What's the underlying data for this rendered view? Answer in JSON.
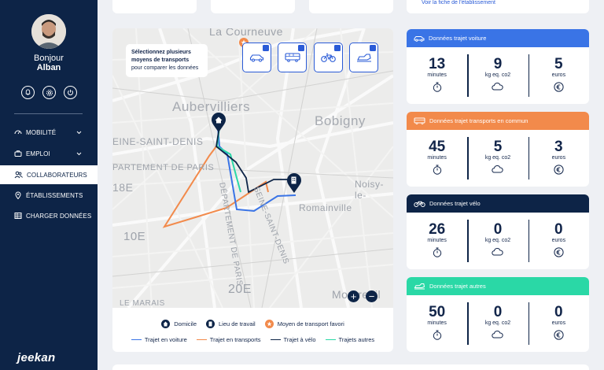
{
  "user": {
    "greeting": "Bonjour",
    "name": "Alban"
  },
  "nav": [
    {
      "label": "MOBILITÉ",
      "icon": "dashboard-icon",
      "has_chevron": true,
      "active": false
    },
    {
      "label": "EMPLOI",
      "icon": "briefcase-icon",
      "has_chevron": true,
      "active": false
    },
    {
      "label": "COLLABORATEURS",
      "icon": "users-icon",
      "has_chevron": false,
      "active": true
    },
    {
      "label": "ÉTABLISSEMENTS",
      "icon": "location-pin-icon",
      "has_chevron": false,
      "active": false
    },
    {
      "label": "CHARGER DONNÉES",
      "icon": "table-icon",
      "has_chevron": false,
      "active": false
    }
  ],
  "brand": {
    "logo": "jeekan"
  },
  "top_link": "Voir la fiche de l'établissement",
  "map": {
    "tip_bold": "Sélectionnez plusieurs moyens de transports",
    "tip_rest": "pour comparer les données",
    "labels": [
      "La Courneuve",
      "Aubervilliers",
      "Bobigny",
      "EINE-SAINT-DENIS",
      "PARTEMENT DE PARIS",
      "18E",
      "Noisy-le-",
      "Romainville",
      "10E",
      "DÉPARTEMENT DE PARIS",
      "SEINE-SAINT-DENIS",
      "20E",
      "Montreuil",
      "LE MARAIS"
    ],
    "legend_markers": [
      "Domicile",
      "Lieu de travail",
      "Moyen de transport favori"
    ],
    "legend_lines": [
      "Trajet en voiture",
      "Trajet en transports",
      "Trajet à vélo",
      "Trajets autres"
    ],
    "zoom_in": "+",
    "zoom_out": "−"
  },
  "colors": {
    "car": "#3a74e6",
    "transit": "#f28a4b",
    "bike": "#0d2447",
    "other": "#2ad8a6",
    "navy": "#0d2447"
  },
  "panels": [
    {
      "title": "Données trajet voiture",
      "minutes": "13",
      "co2": "9",
      "euros": "5"
    },
    {
      "title": "Données trajet transports en commun",
      "minutes": "45",
      "co2": "5",
      "euros": "3"
    },
    {
      "title": "Données trajet vélo",
      "minutes": "26",
      "co2": "0",
      "euros": "0"
    },
    {
      "title": "Données trajet autres",
      "minutes": "50",
      "co2": "0",
      "euros": "0"
    }
  ],
  "units": {
    "minutes": "minutes",
    "co2": "kg eq. co2",
    "euros": "euros"
  }
}
